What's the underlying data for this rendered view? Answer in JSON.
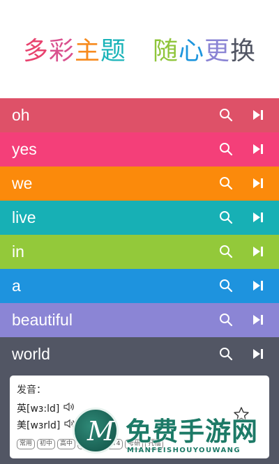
{
  "header": {
    "left": [
      {
        "ch": "多",
        "color": "#e8436f"
      },
      {
        "ch": "彩",
        "color": "#d9508e"
      },
      {
        "ch": "主",
        "color": "#f78a1d"
      },
      {
        "ch": "题",
        "color": "#19b3b8"
      }
    ],
    "right": [
      {
        "ch": "随",
        "color": "#8fc53a"
      },
      {
        "ch": "心",
        "color": "#1d95dd"
      },
      {
        "ch": "更",
        "color": "#8a84d4"
      },
      {
        "ch": "换",
        "color": "#525664"
      }
    ]
  },
  "words": [
    {
      "text": "oh",
      "color": "#de5168"
    },
    {
      "text": "yes",
      "color": "#f43f79"
    },
    {
      "text": "we",
      "color": "#fb8a0b"
    },
    {
      "text": "live",
      "color": "#17b0b5"
    },
    {
      "text": "in",
      "color": "#93c93a"
    },
    {
      "text": "a",
      "color": "#1e93de"
    },
    {
      "text": "beautiful",
      "color": "#8b85d5"
    },
    {
      "text": "world",
      "color": "#525664"
    }
  ],
  "icons": {
    "search": "search-icon",
    "play": "play-next-icon",
    "speaker": "speaker-icon",
    "star": "star-icon"
  },
  "detail": {
    "title": "发音：",
    "uk": "英[wɜ:ld]",
    "us": "美[wɜrld]",
    "tags": [
      "常用",
      "初中",
      "高中",
      "CET4",
      "CET4",
      "考研",
      "托福"
    ]
  },
  "watermark": {
    "logo_letter": "M",
    "title": "免费手游网",
    "subtitle": "MIANFEISHOUYOUWANG"
  }
}
